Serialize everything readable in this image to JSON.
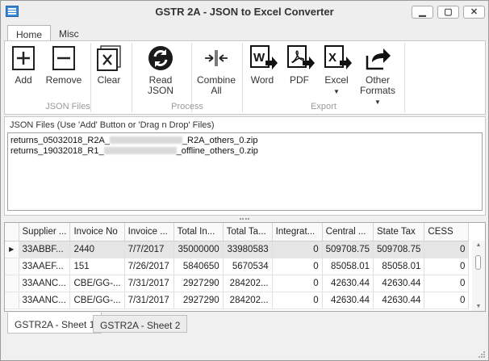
{
  "window": {
    "title": "GSTR 2A - JSON to Excel Converter",
    "controls": [
      "▁",
      "▢",
      "✕"
    ]
  },
  "ribbon_tabs": [
    "Home",
    "Misc"
  ],
  "ribbon": {
    "json_files": {
      "label": "JSON Files",
      "add": "Add",
      "remove": "Remove",
      "clear": "Clear"
    },
    "process": {
      "label": "Process",
      "read_json": "Read JSON",
      "combine_1": "Combine",
      "combine_2": "All"
    },
    "export": {
      "label": "Export",
      "word": "Word",
      "pdf": "PDF",
      "excel": "Excel",
      "other_1": "Other",
      "other_2": "Formats"
    }
  },
  "files_panel": {
    "title": "JSON Files (Use 'Add' Button or 'Drag n Drop' Files)",
    "files": [
      {
        "prefix": "returns_05032018_R2A_",
        "suffix": "_R2A_others_0.zip"
      },
      {
        "prefix": "returns_19032018_R1_",
        "suffix": "_offline_others_0.zip"
      }
    ]
  },
  "grid": {
    "columns": [
      "Supplier ...",
      "Invoice No",
      "Invoice ...",
      "Total In...",
      "Total Ta...",
      "Integrat...",
      "Central ...",
      "State Tax",
      "CESS"
    ],
    "rows": [
      [
        "33ABBF...",
        "2440",
        "7/7/2017",
        "35000000",
        "33980583",
        "0",
        "509708.75",
        "509708.75",
        "0"
      ],
      [
        "33AAEF...",
        "151",
        "7/26/2017",
        "5840650",
        "5670534",
        "0",
        "85058.01",
        "85058.01",
        "0"
      ],
      [
        "33AANC...",
        "CBE/GG-...",
        "7/31/2017",
        "2927290",
        "284202...",
        "0",
        "42630.44",
        "42630.44",
        "0"
      ],
      [
        "33AANC...",
        "CBE/GG-...",
        "7/31/2017",
        "2927290",
        "284202...",
        "0",
        "42630.44",
        "42630.44",
        "0"
      ]
    ]
  },
  "sheet_tabs": [
    "GSTR2A - Sheet 1",
    "GSTR2A - Sheet 2"
  ]
}
